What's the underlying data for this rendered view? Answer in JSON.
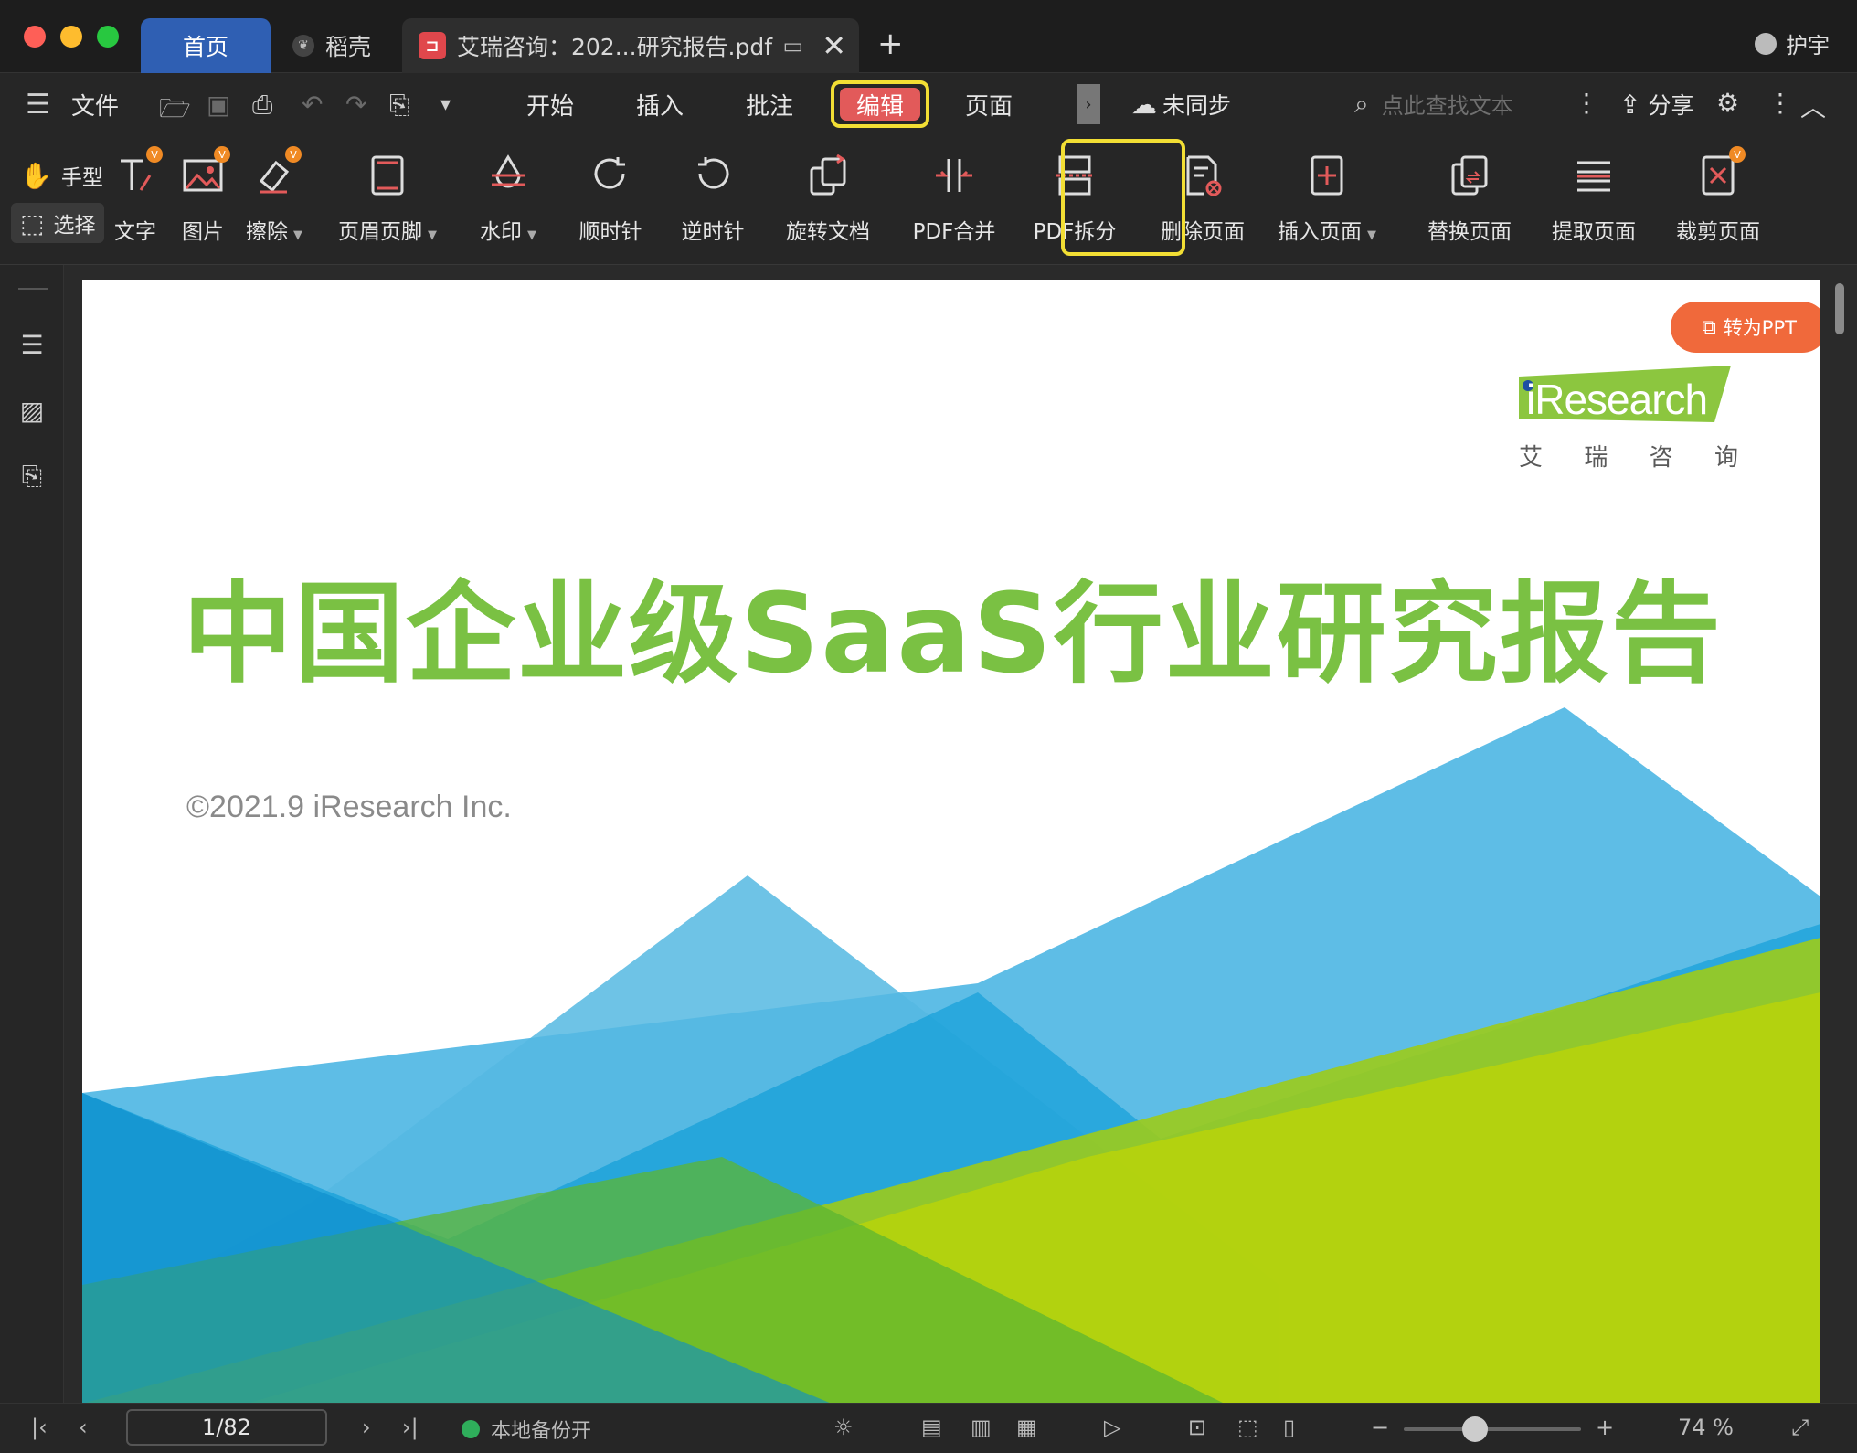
{
  "titlebar": {
    "tabs": [
      {
        "label": "首页"
      },
      {
        "label": "稻壳"
      },
      {
        "label": "艾瑞咨询：202...研究报告.pdf"
      }
    ],
    "add_tab": "+",
    "user": "护宇"
  },
  "menubar": {
    "file": "文件",
    "tabs": [
      "开始",
      "插入",
      "批注",
      "编辑",
      "页面"
    ],
    "sync": "未同步",
    "search_placeholder": "点此查找文本",
    "share": "分享"
  },
  "toolbar": {
    "modes": {
      "hand": "手型",
      "select": "选择"
    },
    "tools": [
      {
        "label": "文字",
        "icon": "text-edit-icon",
        "vip": true
      },
      {
        "label": "图片",
        "icon": "image-edit-icon",
        "vip": true
      },
      {
        "label": "擦除",
        "icon": "eraser-icon",
        "vip": true,
        "dropdown": true
      },
      {
        "label": "页眉页脚",
        "icon": "header-footer-icon",
        "dropdown": true
      },
      {
        "label": "水印",
        "icon": "watermark-icon",
        "dropdown": true
      },
      {
        "label": "顺时针",
        "icon": "rotate-clockwise-icon"
      },
      {
        "label": "逆时针",
        "icon": "rotate-counterclockwise-icon"
      },
      {
        "label": "旋转文档",
        "icon": "rotate-document-icon"
      },
      {
        "label": "PDF合并",
        "icon": "pdf-merge-icon"
      },
      {
        "label": "PDF拆分",
        "icon": "pdf-split-icon"
      },
      {
        "label": "删除页面",
        "icon": "delete-page-icon"
      },
      {
        "label": "插入页面",
        "icon": "insert-page-icon",
        "dropdown": true
      },
      {
        "label": "替换页面",
        "icon": "replace-page-icon"
      },
      {
        "label": "提取页面",
        "icon": "extract-page-icon"
      },
      {
        "label": "裁剪页面",
        "icon": "crop-page-icon",
        "vip": true
      }
    ]
  },
  "document": {
    "convert_button": "转为PPT",
    "logo_text": "iResearch",
    "logo_cn": [
      "艾",
      "瑞",
      "咨",
      "询"
    ],
    "title": "中国企业级SaaS行业研究报告",
    "copyright": "©2021.9 iResearch Inc."
  },
  "statusbar": {
    "page": "1/82",
    "backup": "本地备份开",
    "zoom": "74 %"
  },
  "colors": {
    "accent_green": "#7ac143",
    "highlight_yellow": "#f2de34",
    "edit_tab_red": "#e25a5a",
    "convert_orange": "#f0693b",
    "home_tab_blue": "#2f5fb3"
  }
}
